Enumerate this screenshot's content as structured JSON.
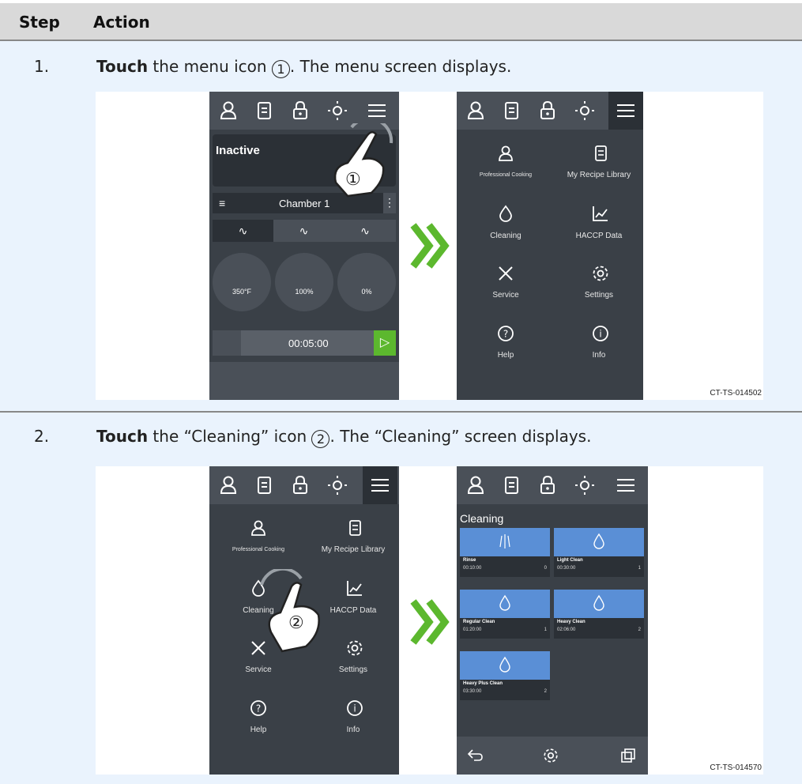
{
  "header": {
    "step_label": "Step",
    "action_label": "Action"
  },
  "steps": [
    {
      "number": "1.",
      "verb": "Touch",
      "text_before": " the menu icon ",
      "circle": "1",
      "text_after": ". The menu screen displays.",
      "figure_code": "CT-TS-014502"
    },
    {
      "number": "2.",
      "verb": "Touch",
      "text_before": " the “Cleaning” icon ",
      "circle": "2",
      "text_after": ". The “Cleaning” screen displays.",
      "figure_code": "CT-TS-014570"
    }
  ],
  "main_screen": {
    "status": "Inactive",
    "chamber": "Chamber 1",
    "temp": "350°F",
    "fan": "100%",
    "humidity": "0%",
    "timer": "00:05:00",
    "callout": "①"
  },
  "menu": {
    "items": [
      {
        "label": "Professional Cooking",
        "icon": "chef-icon"
      },
      {
        "label": "My Recipe Library",
        "icon": "recipe-book-icon"
      },
      {
        "label": "Cleaning",
        "icon": "droplet-icon"
      },
      {
        "label": "HACCP Data",
        "icon": "chart-icon"
      },
      {
        "label": "Service",
        "icon": "tools-icon"
      },
      {
        "label": "Settings",
        "icon": "gear-icon"
      },
      {
        "label": "Help",
        "icon": "question-icon"
      },
      {
        "label": "Info",
        "icon": "info-icon"
      }
    ],
    "callout": "②"
  },
  "cleaning": {
    "title": "Cleaning",
    "programs": [
      {
        "name": "Rinse",
        "time": "00:10:00",
        "count": "0"
      },
      {
        "name": "Light Clean",
        "time": "00:30:00",
        "count": "1"
      },
      {
        "name": "Regular Clean",
        "time": "01:20:00",
        "count": "1"
      },
      {
        "name": "Heavy Clean",
        "time": "02:06:00",
        "count": "2"
      },
      {
        "name": "Heavy Plus Clean",
        "time": "03:30:00",
        "count": "2"
      }
    ]
  },
  "colors": {
    "panel": "#3a4047",
    "topbar": "#4a5058",
    "accent_green": "#5cb82e",
    "card_blue": "#5a8fd6"
  }
}
